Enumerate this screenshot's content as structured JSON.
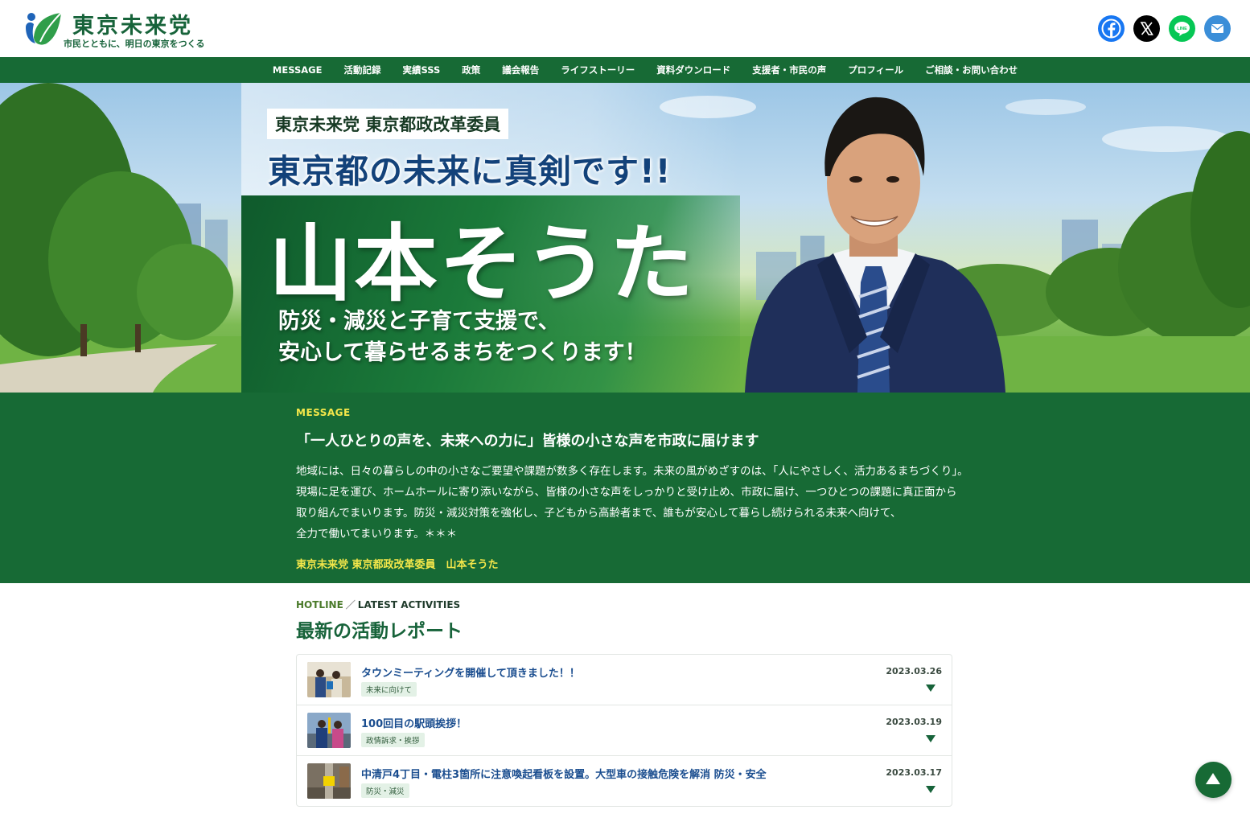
{
  "header": {
    "logo_title": "東京未来党",
    "logo_subtitle": "市民とともに、明日の東京をつくる",
    "social": [
      {
        "icon": "facebook-icon",
        "color": "#1877f2"
      },
      {
        "icon": "x-icon",
        "color": "#000000"
      },
      {
        "icon": "line-icon",
        "color": "#06c755"
      },
      {
        "icon": "mail-icon",
        "color": "#3b8ed8"
      }
    ]
  },
  "nav": {
    "items": [
      "MESSAGE",
      "活動記録",
      "実績SSS",
      "政策",
      "議会報告",
      "ライフストーリー",
      "資料ダウンロード",
      "支援者・市民の声",
      "プロフィール",
      "ご相談・お問い合わせ"
    ]
  },
  "hero": {
    "badge": "東京未来党 東京都政改革委員",
    "tagline": "東京都の未来に真剣です!!",
    "name": "山本そうた",
    "pledge_line1": "防災・減災と子育て支援で、",
    "pledge_line2": "安心して暮らせるまちをつくります！"
  },
  "message": {
    "label": "MESSAGE",
    "title": "「一人ひとりの声を、未来への力に」皆様の小さな声を市政に届けます",
    "body": [
      "地域には、日々の暮らしの中の小さなご要望や課題が数多く存在します。未来の風がめざすのは、「人にやさしく、活力あるまちづくり」。",
      "現場に足を運び、ホームホールに寄り添いながら、皆様の小さな声をしっかりと受け止め、市政に届け、一つひとつの課題に真正面から",
      "取り組んでまいります。防災・減災対策を強化し、子どもから高齢者まで、誰もが安心して暮らし続けられる未来へ向けて、",
      "全力で働いてまいります。＊＊＊"
    ],
    "signature": "東京未来党 東京都政改革委員　山本そうた"
  },
  "activities": {
    "eyebrow_hot": "HOTLINE",
    "eyebrow_sep": "／",
    "eyebrow_latest": "LATEST ACTIVITIES",
    "title": "最新の活動レポート",
    "items": [
      {
        "title": "タウンミーティングを開催して頂きました！！",
        "tag": "未来に向けて",
        "date": "2023.03.26"
      },
      {
        "title": "100回目の駅頭挨拶！",
        "tag": "政情訴求・挨拶",
        "date": "2023.03.19"
      },
      {
        "title": "中清戸4丁目・電柱3箇所に注意喚起看板を設置。大型車の接触危険を解消 防災・安全",
        "tag": "防災・減災",
        "date": "2023.03.17"
      }
    ]
  },
  "colors": {
    "brand_green": "#176a35",
    "accent_yellow": "#f4e74a",
    "link_blue": "#1a4d8f"
  }
}
